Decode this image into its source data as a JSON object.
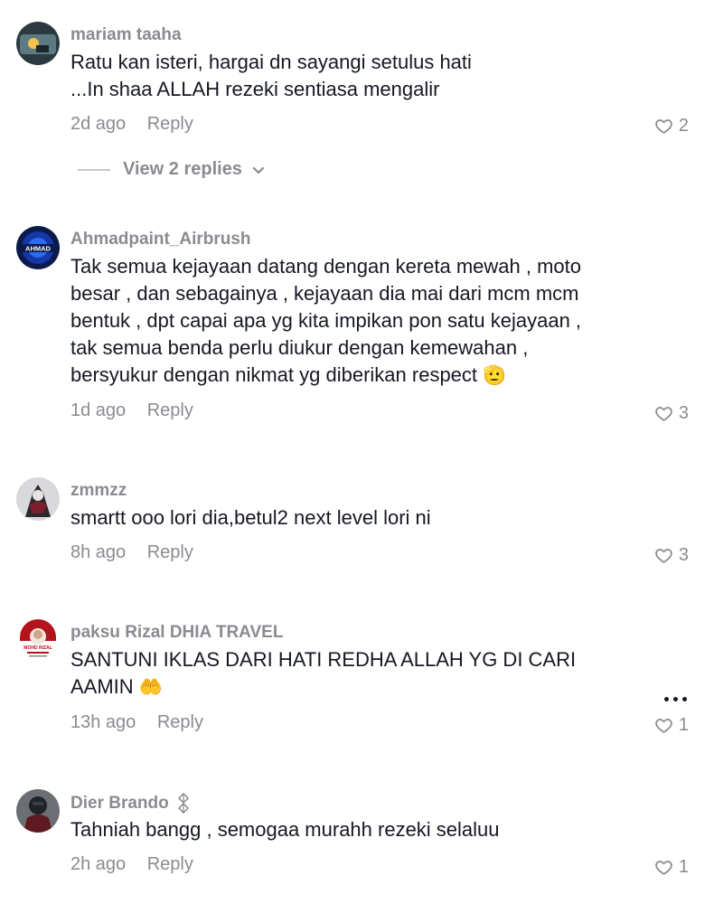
{
  "comments": [
    {
      "username": "mariam taaha",
      "lines": [
        "Ratu kan isteri, hargai dn sayangi setulus hati",
        "...In shaa ALLAH rezeki sentiasa mengalir"
      ],
      "time": "2d ago",
      "reply_label": "Reply",
      "likes": "2",
      "view_replies": "View 2 replies"
    },
    {
      "username": "Ahmadpaint_Airbrush",
      "avatar_text": "AHMAD",
      "lines": [
        "Tak semua kejayaan datang dengan kereta mewah , moto",
        "besar , dan sebagainya , kejayaan dia mai dari mcm mcm",
        "bentuk , dpt capai apa yg kita impikan pon satu kejayaan ,",
        "tak semua benda perlu diukur dengan kemewahan ,",
        "bersyukur dengan nikmat yg diberikan respect"
      ],
      "emoji": "🫡",
      "time": "1d ago",
      "reply_label": "Reply",
      "likes": "3"
    },
    {
      "username": "zmmzz",
      "lines": [
        "smartt ooo lori dia,betul2 next level lori ni"
      ],
      "time": "8h ago",
      "reply_label": "Reply",
      "likes": "3"
    },
    {
      "username": "paksu Rizal DHIA TRAVEL",
      "avatar_text": "MOHD RIZAL",
      "lines": [
        "SANTUNI IKLAS DARI HATI REDHA ALLAH YG DI CARI",
        "AAMIN"
      ],
      "emoji": "🤲",
      "time": "13h ago",
      "reply_label": "Reply",
      "likes": "1"
    },
    {
      "username": "Dier Brando",
      "lines": [
        "Tahniah bangg , semogaa murahh rezeki selaluu"
      ],
      "time": "2h ago",
      "reply_label": "Reply",
      "likes": "1"
    }
  ],
  "icons": {
    "like": "heart-outline-icon",
    "more": "more-horizontal-icon",
    "chevron": "chevron-down-icon"
  },
  "colors": {
    "text": "#161823",
    "muted": "#8a8b91"
  }
}
